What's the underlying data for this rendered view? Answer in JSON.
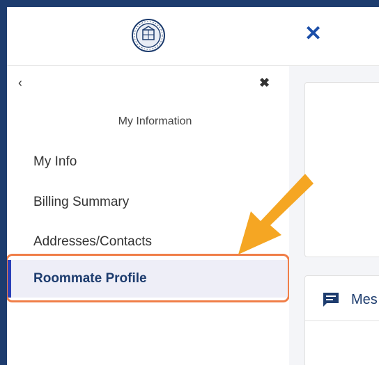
{
  "logo": {
    "icon": "university-seal"
  },
  "sidebar": {
    "back_icon": "‹",
    "close_icon": "✖",
    "section_title": "My Information",
    "items": [
      {
        "label": "My Info",
        "selected": false
      },
      {
        "label": "Billing Summary",
        "selected": false
      },
      {
        "label": "Addresses/Contacts",
        "selected": false
      },
      {
        "label": "Roommate Profile",
        "selected": true
      }
    ]
  },
  "main": {
    "close_icon": "✕",
    "message_label": "Mes"
  },
  "colors": {
    "accent": "#2a3fb8",
    "highlight": "#f07e48",
    "arrow": "#f5a623",
    "navy": "#1d3c6e"
  }
}
